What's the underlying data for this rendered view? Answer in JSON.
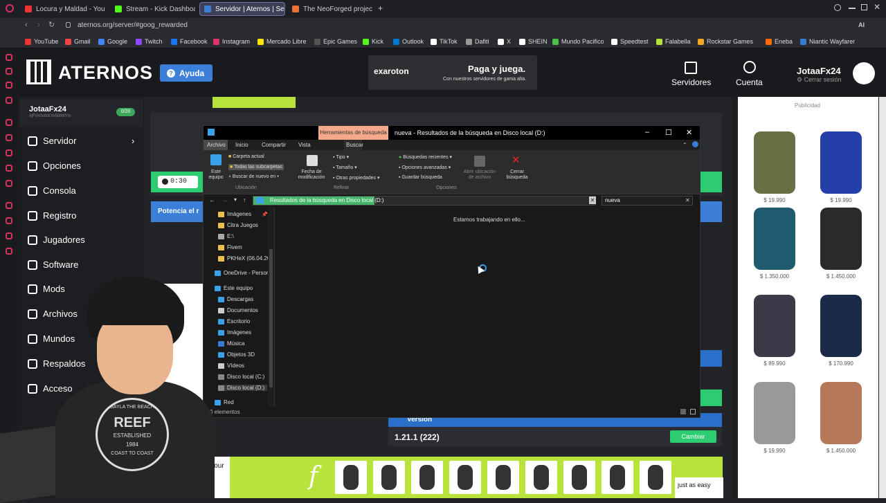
{
  "browser": {
    "tabs": [
      {
        "label": "Locura y Maldad - You",
        "color": "#e33"
      },
      {
        "label": "Stream - Kick Dashboard",
        "color": "#53fc18"
      },
      {
        "label": "Servidor | Aternos | Servi",
        "color": "#3b7fd9"
      },
      {
        "label": "The NeoForged project",
        "color": "#e8743b"
      }
    ],
    "new_tab": "+",
    "url": "aternos.org/server/#goog_rewarded",
    "bookmarks": [
      "YouTube",
      "Gmail",
      "Google",
      "Twitch",
      "Facebook",
      "Instagram",
      "Mercado Libre",
      "Epic Games",
      "Kick",
      "Outlook",
      "TikTok",
      "Dafiti",
      "X",
      "SHEIN",
      "Mundo Pacifico",
      "Speedtest",
      "Falabella",
      "Rockstar Games",
      "Eneba",
      "Niantic Wayfarer"
    ]
  },
  "aternos": {
    "brand": "ATERNOS",
    "help": "Ayuda",
    "ad": {
      "brand": "exaroton",
      "title": "Paga y juega.",
      "subtitle": "Con nuestros servidores de gama alta."
    },
    "header": {
      "servers": "Servidores",
      "account": "Cuenta",
      "username": "JotaaFx24",
      "logout": "Cerrar sesión"
    },
    "userbox": {
      "name": "JotaaFx24",
      "id": "#jFVx0vmXYe50tWYm",
      "count": "0/20"
    },
    "nav": [
      "Servidor",
      "Opciones",
      "Consola",
      "Registro",
      "Jugadores",
      "Software",
      "Mods",
      "Archivos",
      "Mundos",
      "Respaldos",
      "Acceso"
    ],
    "timer": "0:30",
    "boost": "Potencia el r",
    "version": {
      "label": "Versión",
      "value": "1.21.1 (222)",
      "change": "Cambiar"
    },
    "bottom_left": "ect to your At",
    "bottom_right": "just as easy"
  },
  "explorer": {
    "context_tab": "Herramientas de búsqueda",
    "title": "nueva - Resultados de la búsqueda en Disco local (D:)",
    "menus": [
      "Archivo",
      "Inicio",
      "Compartir",
      "Vista",
      "Buscar"
    ],
    "ribbon": {
      "este_equipo": "Este equipo",
      "carpeta_actual": "Carpeta actual",
      "todas_sub": "Todas las subcarpetas",
      "buscar_nuevo": "Buscar de nuevo en",
      "ubicacion": "Ubicación",
      "fecha": "Fecha de modificación",
      "tipo": "Tipo",
      "tamano": "Tamaño",
      "otras": "Otras propiedades",
      "refinar": "Refinar",
      "recientes": "Búsquedas recientes",
      "avanzadas": "Opciones avanzadas",
      "guardar": "Guardar búsqueda",
      "abrir_ubic": "Abrir ubicación de archivo",
      "cerrar": "Cerrar búsqueda",
      "opciones": "Opciones"
    },
    "path": "Resultados de la búsqueda en Disco local (D:)",
    "search": "nueva",
    "nav_items": [
      "Imágenes",
      "Citra Juegos",
      "E:\\",
      "Fivem",
      "PKHeX (06.04.20",
      "OneDrive - Person",
      "Este equipo",
      "Descargas",
      "Documentos",
      "Escritorio",
      "Imágenes",
      "Música",
      "Objetos 3D",
      "Vídeos",
      "Disco local (C:)",
      "Disco local (D:)",
      "Red"
    ],
    "working": "Estamos trabajando en ello...",
    "status": "0 elementos"
  },
  "right_ads": {
    "label": "Publicidad",
    "items": [
      {
        "price": "$ 19.990",
        "color": "#6b6f45"
      },
      {
        "price": "$ 19.990",
        "color": "#2340a8"
      },
      {
        "price": "$ 1.350.000",
        "color": "#1f5a6e"
      },
      {
        "price": "$ 1.450.000",
        "color": "#2a2a2a"
      },
      {
        "price": "$ 89.990",
        "color": "#3a3a48"
      },
      {
        "price": "$ 170.990",
        "color": "#1c2a4a"
      },
      {
        "price": "$ 19.990",
        "color": "#999999"
      },
      {
        "price": "$ 1.450.000",
        "color": "#b7785a"
      }
    ]
  },
  "shirt": {
    "top": "SAYLA THE BEACH",
    "brand": "REEF",
    "established": "ESTABLISHED",
    "year": "1984",
    "bottom": "COAST TO COAST"
  }
}
